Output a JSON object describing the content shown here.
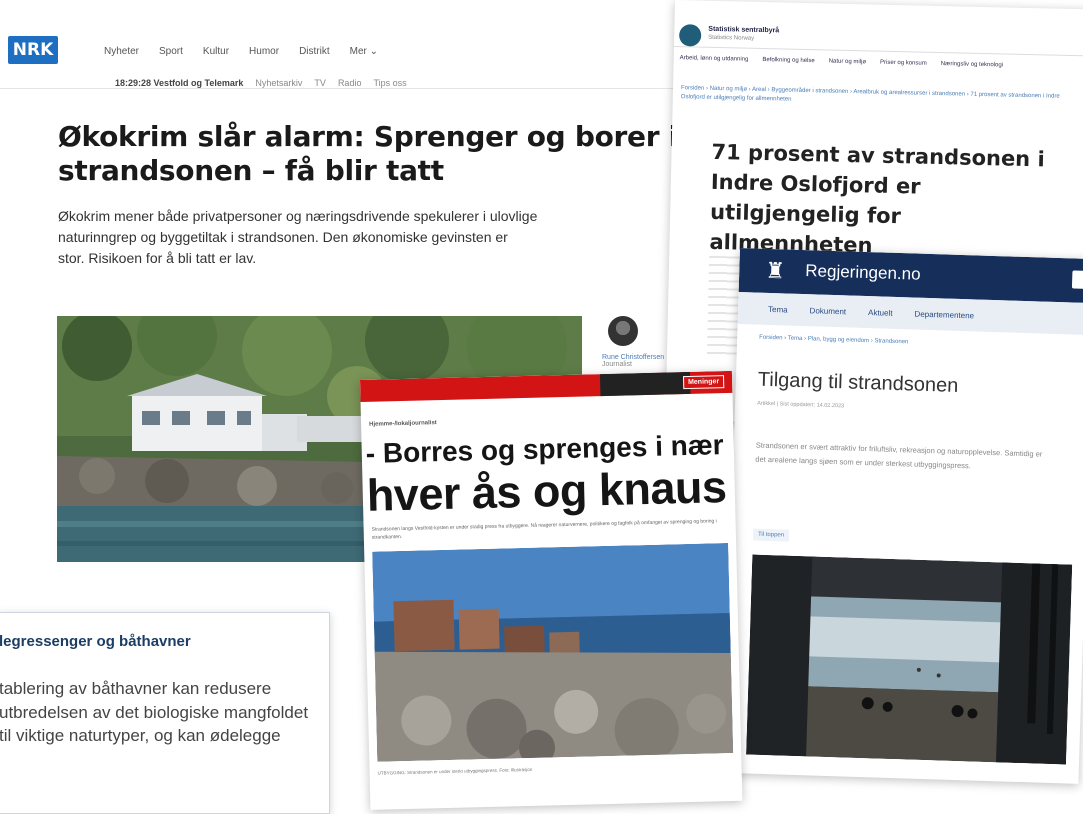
{
  "nrk": {
    "logo": "NRK",
    "nav": [
      "Nyheter",
      "Sport",
      "Kultur",
      "Humor",
      "Distrikt",
      "Mer"
    ],
    "subnav": {
      "time": "18:29:28",
      "region": "Vestfold og Telemark",
      "links": [
        "Nyhetsarkiv",
        "TV",
        "Radio",
        "Tips oss"
      ]
    },
    "headline": "Økokrim slår alarm: Sprenger og borer i strandsonen – få blir tatt",
    "lead": "Økokrim mener både privatpersoner og næringsdrivende spekulerer i ulovlige naturinngrep og byggetiltak i strandsonen. Den økonomiske gevinsten er stor. Risikoen for å bli tatt er lav.",
    "author_name": "Rune Christoffersen",
    "author_role": "Journalist"
  },
  "stats": {
    "org": "Statistisk sentralbyrå",
    "org_sub": "Statistics Norway",
    "tabs": [
      "Arbeid, lønn og utdanning",
      "Befolkning og helse",
      "Natur og miljø",
      "Priser og konsum",
      "Næringsliv og teknologi"
    ],
    "crumbs": "Forsiden › Natur og miljø › Areal › Byggeområder i strandsonen › Arealbruk og arealressurser i strandsonen › 71 prosent av strandsonen i Indre Oslofjord er utilgjengelig for allmennheten",
    "title": "71 prosent av strandsonen i Indre Oslofjord er utilgjengelig for allmennheten"
  },
  "reg": {
    "site": "Regjeringen.no",
    "menu": [
      "Tema",
      "Dokument",
      "Aktuelt",
      "Departementene"
    ],
    "crumbs": "Forsiden › Tema › Plan, bygg og eiendom › Strandsonen",
    "title": "Tilgang til strandsonen",
    "meta": "Artikkel | Sist oppdatert: 14.02.2023",
    "body": "Strandsonen er svært attraktiv for friluftsliv, rekreasjon og naturopplevelse. Samtidig er det arealene langs sjøen som er under sterkest utbyggingspress.",
    "share": "Til toppen"
  },
  "borres": {
    "tag": "Meninger",
    "kicker": "Hjemme-/lokaljournalist",
    "h1": "- Borres og sprenges i nær",
    "h2": "hver ås og knaus",
    "ingress": "Strandsonen langs Vestfold-kysten er under stadig press fra utbyggere. Nå reagerer naturvernere, politikere og fagfolk på omfanget av sprenging og boring i strandkanten.",
    "caption": "UTBYGGING: Strandsonen er under sterkt utbyggingspress. Foto: Illustrasjon"
  },
  "info": {
    "title": "legressenger og båthavner",
    "text": "tablering av båthavner kan redusere utbredelsen av det biologiske mangfoldet til viktige naturtyper, og kan ødelegge"
  }
}
